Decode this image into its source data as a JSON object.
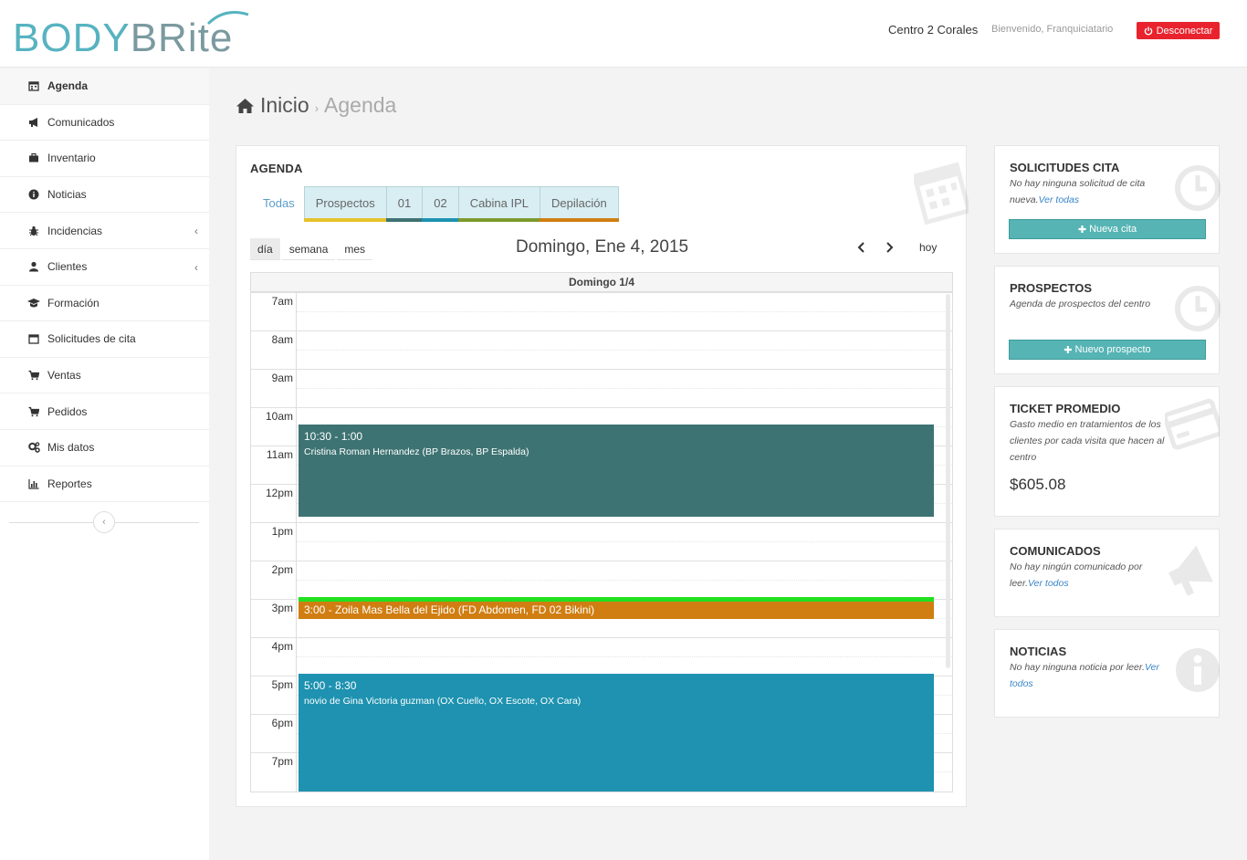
{
  "header": {
    "logo": {
      "part1": "BODY",
      "part2": "BRite"
    },
    "center_name": "Centro 2 Corales",
    "welcome": "Bienvenido, Franquiciatario",
    "logout_label": "Desconectar"
  },
  "sidebar": {
    "items": [
      {
        "label": "Agenda",
        "icon": "calendar-icon",
        "active": true
      },
      {
        "label": "Comunicados",
        "icon": "bullhorn-icon"
      },
      {
        "label": "Inventario",
        "icon": "briefcase-icon"
      },
      {
        "label": "Noticias",
        "icon": "info-circle-icon"
      },
      {
        "label": "Incidencias",
        "icon": "bug-icon",
        "expandable": true
      },
      {
        "label": "Clientes",
        "icon": "user-icon",
        "expandable": true
      },
      {
        "label": "Formación",
        "icon": "graduation-cap-icon"
      },
      {
        "label": "Solicitudes de cita",
        "icon": "calendar-icon"
      },
      {
        "label": "Ventas",
        "icon": "cart-icon"
      },
      {
        "label": "Pedidos",
        "icon": "cart-icon"
      },
      {
        "label": "Mis datos",
        "icon": "cogs-icon"
      },
      {
        "label": "Reportes",
        "icon": "bar-chart-icon"
      }
    ]
  },
  "breadcrumb": {
    "home": "Inicio",
    "current": "Agenda"
  },
  "agenda": {
    "title": "AGENDA",
    "tabs": [
      {
        "label": "Todas",
        "color": ""
      },
      {
        "label": "Prospectos",
        "color": "#e6c22a"
      },
      {
        "label": "01",
        "color": "#3e7373"
      },
      {
        "label": "02",
        "color": "#1e92b0"
      },
      {
        "label": "Cabina IPL",
        "color": "#7c9b2c"
      },
      {
        "label": "Depilación",
        "color": "#d07e12"
      }
    ],
    "views": {
      "day": "día",
      "week": "semana",
      "month": "mes"
    },
    "date_title": "Domingo, Ene 4, 2015",
    "today_label": "hoy",
    "column_header": "Domingo 1/4",
    "hours": [
      "7am",
      "8am",
      "9am",
      "10am",
      "11am",
      "12pm",
      "1pm",
      "2pm",
      "3pm",
      "4pm",
      "5pm",
      "6pm",
      "7pm"
    ],
    "events": [
      {
        "time": "10:30 - 1:00",
        "desc": "Cristina Roman Hernandez (BP Brazos, BP Espalda)",
        "color": "#3e7373"
      },
      {
        "time": "3:00",
        "desc": "Zoila Mas Bella del Ejido (FD Abdomen, FD 02 Bikini)",
        "line": "3:00 - Zoila Mas Bella del Ejido (FD Abdomen, FD 02 Bikini)",
        "color": "#d07e12"
      },
      {
        "time": "5:00 - 8:30",
        "desc": "novio de Gina Victoria guzman (OX Cuello, OX Escote, OX Cara)",
        "color": "#1e92b0"
      }
    ]
  },
  "widgets": {
    "solicitudes": {
      "title": "SOLICITUDES CITA",
      "text": "No hay ninguna solicitud de cita nueva.",
      "link": "Ver todas",
      "button": "Nueva cita"
    },
    "prospectos": {
      "title": "PROSPECTOS",
      "text": "Agenda de prospectos del centro",
      "button": "Nuevo prospecto"
    },
    "ticket": {
      "title": "TICKET PROMEDIO",
      "text": "Gasto medio en tratamientos de los clientes por cada visita que hacen al centro",
      "amount": "$605.08"
    },
    "comunicados": {
      "title": "COMUNICADOS",
      "text": "No hay ningún comunicado por leer.",
      "link": "Ver todos"
    },
    "noticias": {
      "title": "NOTICIAS",
      "text": "No hay ninguna noticia por leer.",
      "link": "Ver todos"
    }
  }
}
